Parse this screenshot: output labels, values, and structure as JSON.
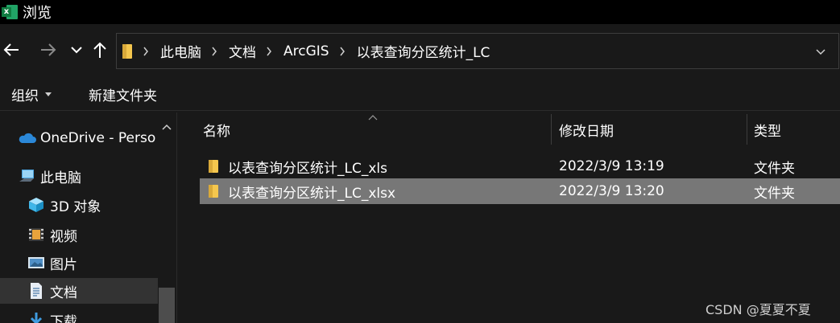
{
  "window": {
    "title": "浏览"
  },
  "nav": {
    "back": "←",
    "forward": "→",
    "recent": "⌄",
    "up": "↑"
  },
  "breadcrumbs": [
    "此电脑",
    "文档",
    "ArcGIS",
    "以表查询分区统计_LC"
  ],
  "toolbar": {
    "organize": "组织",
    "new_folder": "新建文件夹"
  },
  "sidebar": {
    "items": [
      {
        "label": "OneDrive - Perso",
        "icon": "cloud-icon"
      },
      {
        "label": "此电脑",
        "icon": "computer-icon"
      },
      {
        "label": "3D 对象",
        "icon": "cube-icon"
      },
      {
        "label": "视频",
        "icon": "video-icon"
      },
      {
        "label": "图片",
        "icon": "picture-icon"
      },
      {
        "label": "文档",
        "icon": "document-icon",
        "selected": true
      },
      {
        "label": "下载",
        "icon": "download-icon"
      }
    ]
  },
  "table": {
    "columns": [
      "名称",
      "修改日期",
      "类型"
    ],
    "rows": [
      {
        "name": "以表查询分区统计_LC_xls",
        "date": "2022/3/9 13:19",
        "type": "文件夹"
      },
      {
        "name": "以表查询分区统计_LC_xlsx",
        "date": "2022/3/9 13:20",
        "type": "文件夹",
        "selected": true
      }
    ]
  },
  "colors": {
    "background": "#191919",
    "titlebar": "#000000",
    "selection": "#777777",
    "folder": "#f4c64e"
  },
  "watermark": "CSDN @夏夏不夏"
}
